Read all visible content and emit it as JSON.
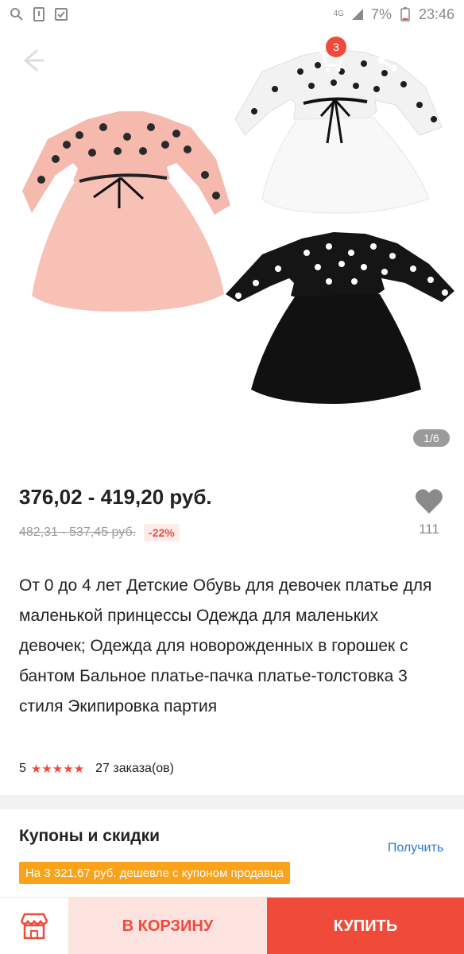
{
  "status_bar": {
    "network": "4G",
    "battery": "7%",
    "time": "23:46",
    "icons": [
      "search-icon",
      "sim-alert-icon",
      "checklist-icon",
      "signal-icon",
      "battery-icon"
    ]
  },
  "appbar": {
    "cart_count": "3",
    "icons": [
      "back-arrow-icon",
      "cart-icon",
      "share-icon",
      "more-vert-icon"
    ]
  },
  "gallery": {
    "page_indicator": "1/6",
    "dresses": [
      "pink-polka-dress",
      "white-polka-dress",
      "black-polka-dress"
    ]
  },
  "product": {
    "price": "376,02 - 419,20 руб.",
    "old_price": "482,31 - 537,45 руб.",
    "discount": "-22%",
    "favorites_count": "111",
    "title": "От 0 до 4 лет Детские Обувь для девочек платье для маленькой принцессы Одежда для маленьких девочек; Одежда для новорожденных в горошек с бантом Бальное платье-пачка платье-толстовка 3 стиля Экипировка партия",
    "rating": "5",
    "stars": "★★★★★",
    "orders": "27 заказа(ов)"
  },
  "coupons": {
    "title": "Купоны и скидки",
    "tag": "На 3 321,67 руб. дешевле с купоном продавца",
    "get_label": "Получить"
  },
  "bottom": {
    "add_to_cart": "В КОРЗИНУ",
    "buy": "КУПИТЬ"
  },
  "colors": {
    "accent": "#f04a3b",
    "coupon": "#f9a21a",
    "link": "#2b78d6"
  }
}
